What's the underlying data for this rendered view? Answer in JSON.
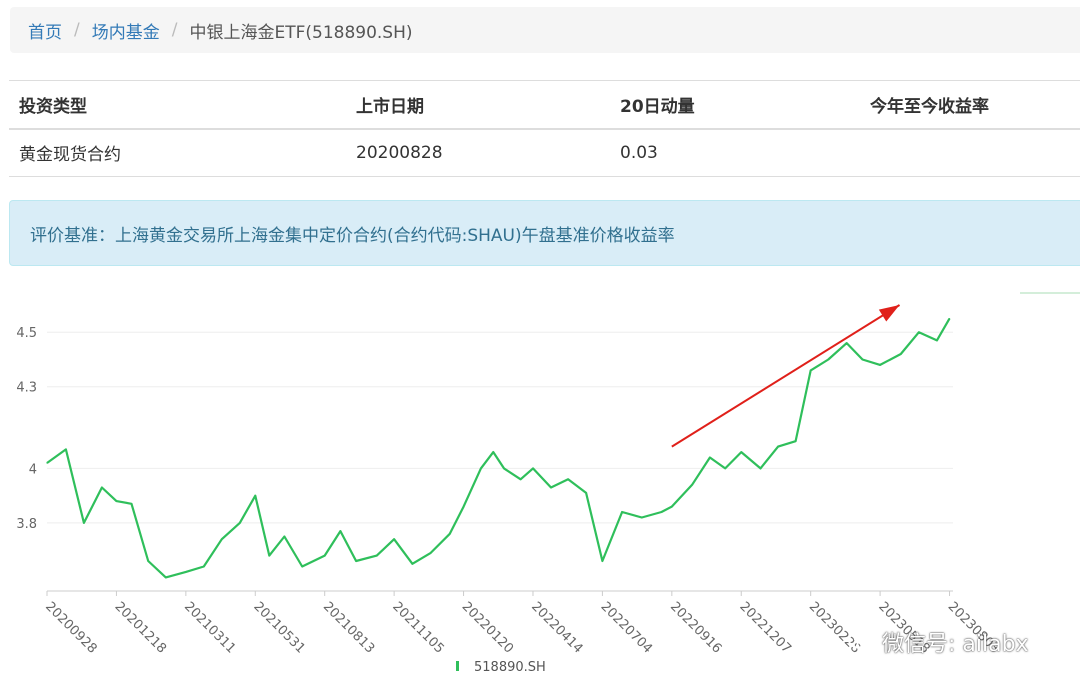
{
  "breadcrumb": {
    "home": "首页",
    "category": "场内基金",
    "current": "中银上海金ETF(518890.SH)"
  },
  "info_table": {
    "headers": [
      "投资类型",
      "上市日期",
      "20日动量",
      "今年至今收益率"
    ],
    "row": [
      "黄金现货合约",
      "20200828",
      "0.03",
      ""
    ]
  },
  "notice": {
    "text": "评价基准：上海黄金交易所上海金集中定价合约(合约代码:SHAU)午盘基准价格收益率"
  },
  "chart_data": {
    "type": "line",
    "x_tick_labels": [
      "20200928",
      "20201218",
      "20210311",
      "20210531",
      "20210813",
      "20211105",
      "20220120",
      "20220414",
      "20220704",
      "20220916",
      "20221207",
      "20230228",
      "20230518",
      "20230803"
    ],
    "y_tick_labels": [
      "3.8",
      "4",
      "4.3",
      "4.5"
    ],
    "ylim": [
      3.55,
      4.6
    ],
    "grid": true,
    "legend_position": "bottom-center",
    "series": [
      {
        "name": "518890.SH",
        "color": "#2fbf5b",
        "x": [
          "20200928",
          "20201020",
          "20201110",
          "20201201",
          "20201218",
          "20210105",
          "20210125",
          "20210215",
          "20210311",
          "20210401",
          "20210422",
          "20210513",
          "20210531",
          "20210615",
          "20210701",
          "20210720",
          "20210813",
          "20210901",
          "20210920",
          "20211015",
          "20211105",
          "20211125",
          "20211215",
          "20220105",
          "20220120",
          "20220210",
          "20220225",
          "20220310",
          "20220330",
          "20220414",
          "20220505",
          "20220525",
          "20220615",
          "20220704",
          "20220725",
          "20220815",
          "20220905",
          "20220916",
          "20221010",
          "20221031",
          "20221118",
          "20221207",
          "20221230",
          "20230120",
          "20230210",
          "20230228",
          "20230320",
          "20230410",
          "20230428",
          "20230518",
          "20230610",
          "20230630",
          "20230720",
          "20230803"
        ],
        "values": [
          4.02,
          4.07,
          3.8,
          3.93,
          3.88,
          3.87,
          3.66,
          3.6,
          3.62,
          3.64,
          3.74,
          3.8,
          3.9,
          3.68,
          3.75,
          3.64,
          3.68,
          3.77,
          3.66,
          3.68,
          3.74,
          3.65,
          3.69,
          3.76,
          3.86,
          4.0,
          4.06,
          4.0,
          3.96,
          4.0,
          3.93,
          3.96,
          3.91,
          3.66,
          3.84,
          3.82,
          3.84,
          3.86,
          3.94,
          4.04,
          4.0,
          4.06,
          4.0,
          4.08,
          4.1,
          4.36,
          4.4,
          4.46,
          4.4,
          4.38,
          4.42,
          4.5,
          4.47,
          4.55
        ]
      }
    ],
    "annotations": [
      {
        "type": "arrow",
        "color": "#e0201a",
        "from": {
          "x": "20220916",
          "y": 4.08
        },
        "to": {
          "x": "20230803",
          "y": 4.6
        }
      }
    ]
  },
  "watermark": {
    "text": "微信号: ailabx"
  }
}
